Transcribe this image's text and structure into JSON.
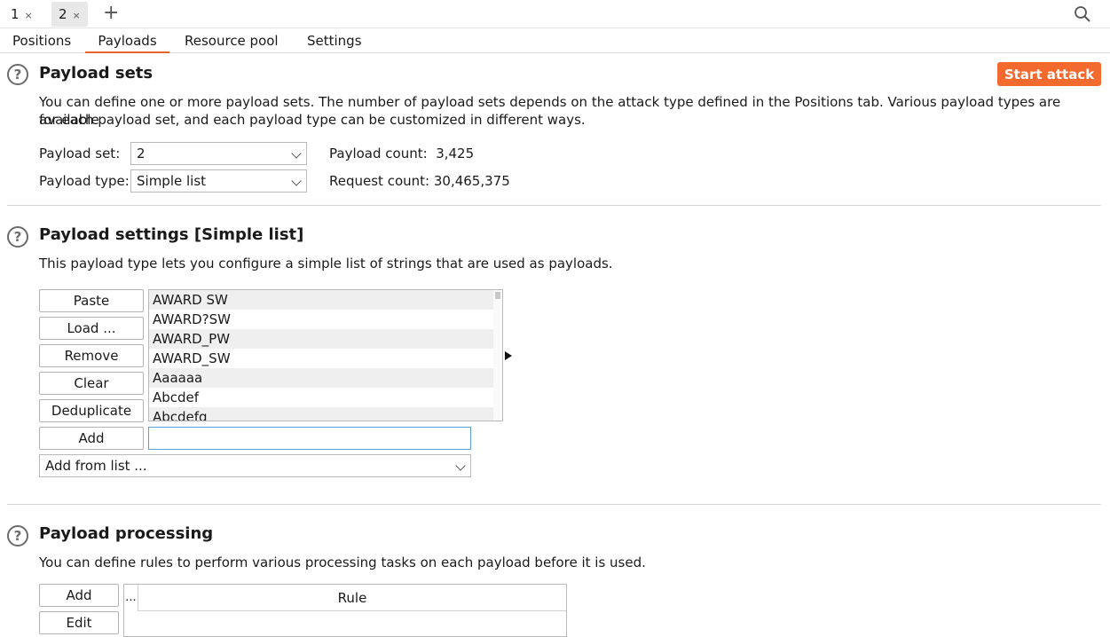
{
  "top_tabs": [
    {
      "label": "1",
      "close": "×"
    },
    {
      "label": "2",
      "close": "×"
    }
  ],
  "new_tab_label": "+",
  "sub_tabs": [
    "Positions",
    "Payloads",
    "Resource pool",
    "Settings"
  ],
  "payload_sets": {
    "title": "Payload sets",
    "start_attack_label": "Start attack",
    "description_line1": "You can define one or more payload sets. The number of payload sets depends on the attack type defined in the Positions tab. Various payload types are available",
    "description_line2": "for each payload set, and each payload type can be customized in different ways.",
    "payload_set_label": "Payload set:",
    "payload_set_value": "2",
    "payload_type_label": "Payload type:",
    "payload_type_value": "Simple list",
    "payload_count_label": "Payload count:",
    "payload_count_value": "3,425",
    "request_count_label": "Request count:",
    "request_count_value": "30,465,375"
  },
  "payload_settings": {
    "title": "Payload settings [Simple list]",
    "description": "This payload type lets you configure a simple list of strings that are used as payloads.",
    "buttons": [
      "Paste",
      "Load ...",
      "Remove",
      "Clear",
      "Deduplicate",
      "Add"
    ],
    "list_items": [
      "AWARD SW",
      "AWARD?SW",
      "AWARD_PW",
      "AWARD_SW",
      "Aaaaaa",
      "Abcdef",
      "Abcdefg"
    ],
    "add_input_value": "",
    "add_from_list_label": "Add from list ..."
  },
  "payload_processing": {
    "title": "Payload processing",
    "description": "You can define rules to perform various processing tasks on each payload before it is used.",
    "buttons": [
      "Add",
      "Edit"
    ],
    "table_header_dots": "...",
    "table_header_rule": "Rule"
  },
  "help_icon_glyph": "?",
  "icons": {
    "search": "search-icon",
    "help": "help-circle-icon",
    "dropdown": "chevron-down-icon",
    "expand": "triangle-right-icon"
  },
  "colors": {
    "accent": "#f26a2e",
    "tab_underline": "#e8652c",
    "input_focus": "#5aa0d8"
  }
}
